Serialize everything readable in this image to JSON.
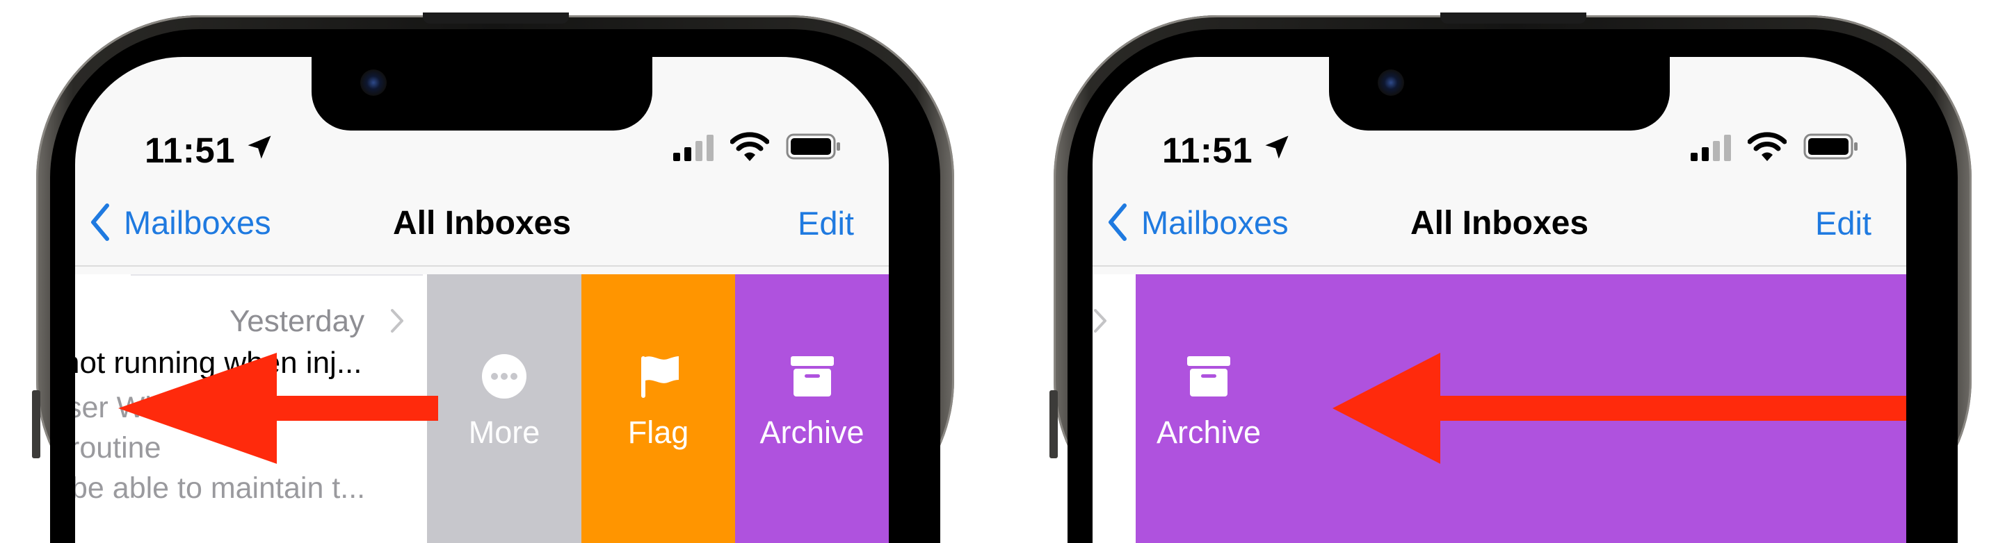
{
  "panels": [
    {
      "status": {
        "time": "11:51"
      },
      "nav": {
        "back_label": "Mailboxes",
        "title": "All Inboxes",
        "edit_label": "Edit"
      },
      "message": {
        "date": "Yesterday",
        "subject": "not running when inj...",
        "preview": [
          "ser What happens",
          "routine",
          "be able to maintain t..."
        ]
      },
      "actions": [
        {
          "label": "More",
          "icon": "ellipsis-circle-icon",
          "color": "#c7c7cc"
        },
        {
          "label": "Flag",
          "icon": "flag-icon",
          "color": "#ff9500"
        },
        {
          "label": "Archive",
          "icon": "archive-box-icon",
          "color": "#af52de"
        }
      ],
      "gesture": {
        "direction": "left",
        "color": "#ff2a0c"
      }
    },
    {
      "status": {
        "time": "11:51"
      },
      "nav": {
        "back_label": "Mailboxes",
        "title": "All Inboxes",
        "edit_label": "Edit"
      },
      "actions": [
        {
          "label": "Archive",
          "icon": "archive-box-icon",
          "color": "#af52de"
        }
      ],
      "gesture": {
        "direction": "left",
        "color": "#ff2a0c"
      }
    }
  ]
}
